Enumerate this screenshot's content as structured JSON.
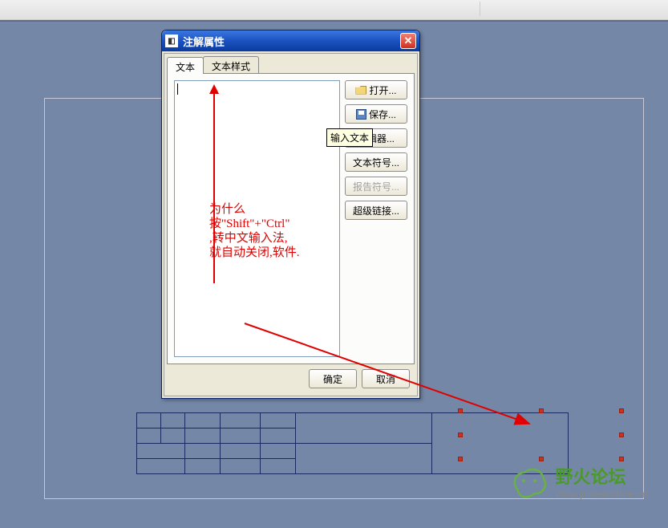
{
  "dialog": {
    "title": "注解属性",
    "tabs": {
      "text": "文本",
      "style": "文本样式"
    },
    "buttons": {
      "open": "打开...",
      "save": "保存...",
      "editor": "编辑器...",
      "symbols": "文本符号...",
      "report": "报告符号...",
      "hyperlink": "超级链接...",
      "ok": "确定",
      "cancel": "取消"
    },
    "tooltip": "输入文本"
  },
  "annotation": {
    "line1": "为什么",
    "line2": "按\"Shift\"+\"Ctrl\"",
    "line3": ",转中文输入法,",
    "line4": "就自动关闭,软件."
  },
  "watermark": {
    "title": "野火论坛",
    "url": "www.proewildfire.cn"
  }
}
